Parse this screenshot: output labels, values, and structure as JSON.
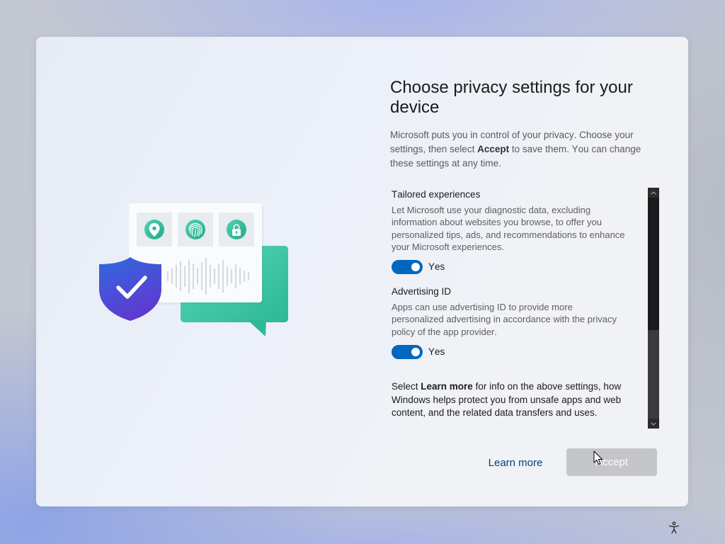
{
  "screen": {
    "title": "Choose privacy settings for your device",
    "intro": {
      "before": "Microsoft puts you in control of your privacy. Choose your settings, then select ",
      "bold": "Accept",
      "after": " to save them. You can change these settings at any time."
    }
  },
  "settings": [
    {
      "heading": "Tailored experiences",
      "description": "Let Microsoft use your diagnostic data, excluding information about websites you browse, to offer you personalized tips, ads, and recommendations to enhance your Microsoft experiences.",
      "enabled": true,
      "state_label": "Yes"
    },
    {
      "heading": "Advertising ID",
      "description": "Apps can use advertising ID to provide more personalized advertising in accordance with the privacy policy of the app provider.",
      "enabled": true,
      "state_label": "Yes"
    }
  ],
  "footnote": {
    "before": "Select ",
    "bold": "Learn more",
    "after": " for info on the above settings, how Windows helps protect you from unsafe apps and web content, and the related data transfers and uses."
  },
  "scroll": {
    "position": 0,
    "visible_fraction": 0.6
  },
  "actions": {
    "learn_more": "Learn more",
    "accept": "Accept",
    "accept_enabled": false
  },
  "illustration": {
    "icons": [
      "shield-check-icon",
      "location-pin-icon",
      "fingerprint-icon",
      "lock-icon"
    ]
  },
  "system": {
    "accessibility_icon": "accessibility-icon",
    "pointer_icon": "mouse-pointer-icon"
  },
  "colors": {
    "accent": "#0067c0",
    "link": "#00427a",
    "accept_button": "#c5c6ca",
    "scrollbar": "#2c2c2c",
    "shield_top": "#2f6ae0",
    "shield_bottom": "#5e3ad0",
    "teal_light": "#4fd3b2",
    "teal_dark": "#23a986",
    "bubble_light": "#58d6bb",
    "bubble_dark": "#2db893"
  }
}
